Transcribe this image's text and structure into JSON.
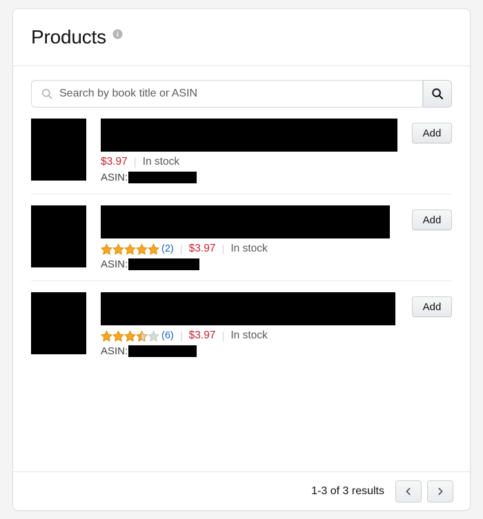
{
  "header": {
    "title": "Products",
    "info_icon": "info-icon"
  },
  "search": {
    "placeholder": "Search by book title or ASIN",
    "value": "",
    "input_icon": "search-icon",
    "button_icon": "search-icon"
  },
  "products": [
    {
      "title_redacted": true,
      "rating": null,
      "review_count": null,
      "price": "$3.97",
      "availability": "In stock",
      "asin_label": "ASIN:",
      "asin_redacted": true,
      "add_label": "Add",
      "thumb_width": 80,
      "thumb_height": 90,
      "title_width": 430,
      "asin_width": 99
    },
    {
      "title_redacted": true,
      "rating": 5,
      "review_count": "(2)",
      "price": "$3.97",
      "availability": "In stock",
      "asin_label": "ASIN:",
      "asin_redacted": true,
      "add_label": "Add",
      "thumb_width": 80,
      "thumb_height": 90,
      "title_width": 419,
      "asin_width": 103
    },
    {
      "title_redacted": true,
      "rating": 3.5,
      "review_count": "(6)",
      "price": "$3.97",
      "availability": "In stock",
      "asin_label": "ASIN:",
      "asin_redacted": true,
      "add_label": "Add",
      "thumb_width": 80,
      "thumb_height": 90,
      "title_width": 427,
      "asin_width": 99
    }
  ],
  "separator": "|",
  "footer": {
    "results_text": "1-3 of 3 results",
    "prev_icon": "chevron-left-icon",
    "next_icon": "chevron-right-icon"
  },
  "colors": {
    "price": "#c7202a",
    "link": "#1565c0",
    "star_filled": "#f6a623",
    "star_empty": "#d5d9d9",
    "page_bg": "#f4f4f4",
    "card_bg": "#ffffff"
  }
}
